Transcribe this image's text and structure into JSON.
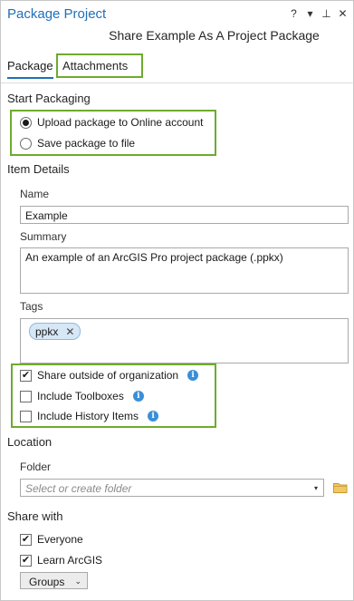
{
  "window": {
    "title": "Package Project",
    "controls": {
      "help": "?",
      "menu": "▾",
      "pin": "⊥",
      "close": "✕"
    },
    "subtitle": "Share Example As A Project Package"
  },
  "tabs": [
    {
      "label": "Package",
      "active": true
    },
    {
      "label": "Attachments",
      "active": false
    }
  ],
  "start_packaging": {
    "heading": "Start Packaging",
    "options": [
      {
        "label": "Upload package to Online account",
        "selected": true
      },
      {
        "label": "Save package to file",
        "selected": false
      }
    ]
  },
  "item_details": {
    "heading": "Item Details",
    "name_label": "Name",
    "name_value": "Example",
    "summary_label": "Summary",
    "summary_value": "An example of an ArcGIS Pro project package (.ppkx)",
    "tags_label": "Tags",
    "tags": [
      {
        "label": "ppkx",
        "remove": "✕"
      }
    ],
    "options": [
      {
        "label": "Share outside of organization",
        "checked": true,
        "info": "i"
      },
      {
        "label": "Include Toolboxes",
        "checked": false,
        "info": "i"
      },
      {
        "label": "Include History Items",
        "checked": false,
        "info": "i"
      }
    ]
  },
  "location": {
    "heading": "Location",
    "folder_label": "Folder",
    "folder_placeholder": "Select or create folder",
    "folder_arrow": "▾"
  },
  "share_with": {
    "heading": "Share with",
    "options": [
      {
        "label": "Everyone",
        "checked": true
      },
      {
        "label": "Learn ArcGIS",
        "checked": true
      }
    ],
    "groups_select": "Groups",
    "groups_chevron": "⌄"
  },
  "colors": {
    "accent": "#1f6fba",
    "highlight": "#6eaa2e",
    "info": "#3a8fd8",
    "tag_fill": "#d6e7f6",
    "folder": "#e8b84a"
  }
}
